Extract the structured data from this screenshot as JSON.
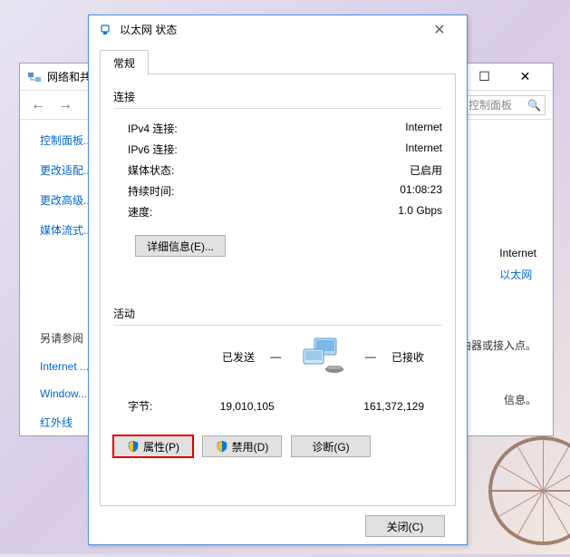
{
  "bg": {
    "title": "网络和共",
    "breadcrumb_end": "控制面板",
    "side": {
      "home": "控制面板...",
      "adapter": "更改适配...",
      "advanced": "更改高级...",
      "media": "媒体流式...",
      "see_also": "另请参阅",
      "internet": "Internet ...",
      "firewall": "Window...",
      "infrared": "红外线"
    },
    "main": {
      "internet_label": "Internet",
      "ethernet_link": "以太网",
      "router_text": "由器或接入点。",
      "info_text": "信息。"
    }
  },
  "dlg": {
    "title": "以太网 状态",
    "tab_general": "常规",
    "section_connection": "连接",
    "ipv4_label": "IPv4 连接:",
    "ipv4_value": "Internet",
    "ipv6_label": "IPv6 连接:",
    "ipv6_value": "Internet",
    "media_label": "媒体状态:",
    "media_value": "已启用",
    "duration_label": "持续时间:",
    "duration_value": "01:08:23",
    "speed_label": "速度:",
    "speed_value": "1.0 Gbps",
    "details_btn": "详细信息(E)...",
    "section_activity": "活动",
    "sent_label": "已发送",
    "recv_label": "已接收",
    "bytes_label": "字节:",
    "bytes_sent": "19,010,105",
    "bytes_recv": "161,372,129",
    "properties_btn": "属性(P)",
    "disable_btn": "禁用(D)",
    "diagnose_btn": "诊断(G)",
    "close_btn": "关闭(C)"
  }
}
